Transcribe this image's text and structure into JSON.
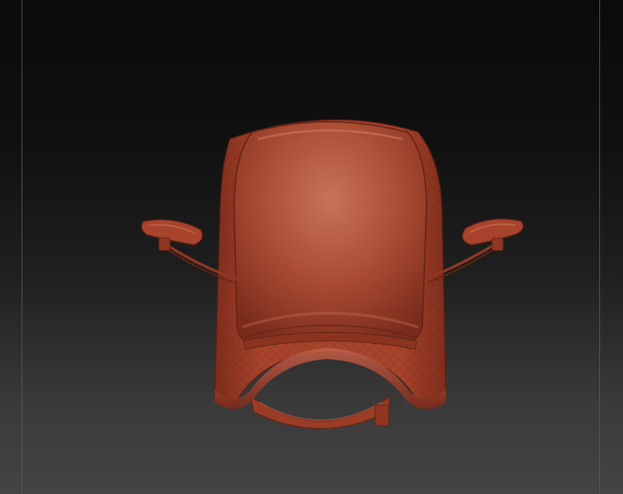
{
  "viewport": {
    "background_top": "#0b0b0b",
    "background_bottom": "#444444",
    "frame_color": "#5a5a5a"
  },
  "model": {
    "subject": "saddle",
    "material_color": "#a8442c",
    "highlight_color": "#c4664a",
    "shadow_color": "#5e2014"
  }
}
